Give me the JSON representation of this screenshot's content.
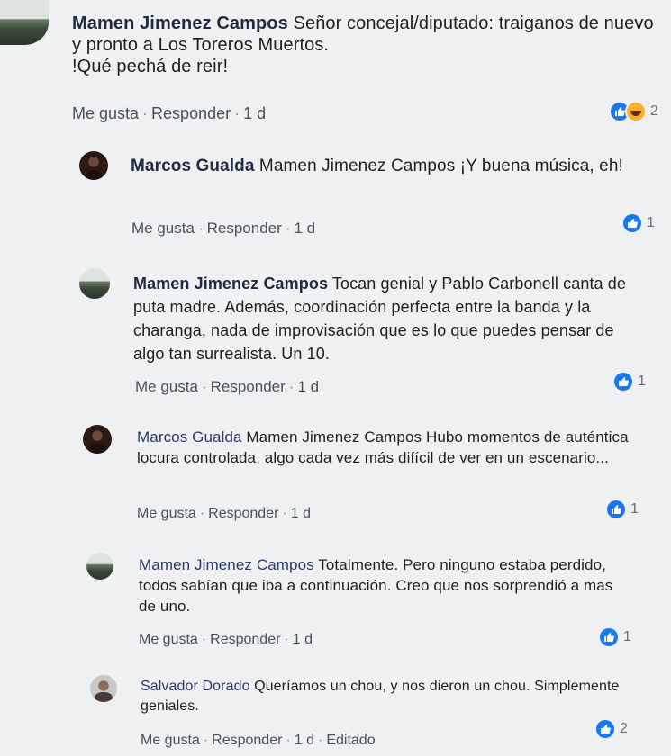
{
  "comments": [
    {
      "author": "Mamen Jimenez Campos",
      "text": "Señor concejal/diputado: traiganos de nuevo y pronto a Los Toreros Muertos.",
      "text2": "!Qué pechá de reir!",
      "like": "Me gusta",
      "reply": "Responder",
      "time": "1 d",
      "reaction_count": "2"
    },
    {
      "author": "Marcos Gualda",
      "text": "Mamen Jimenez Campos ¡Y buena música, eh!",
      "like": "Me gusta",
      "reply": "Responder",
      "time": "1 d",
      "reaction_count": "1"
    },
    {
      "author": "Mamen Jimenez Campos",
      "text": "Tocan genial y Pablo Carbonell canta de puta madre. Además, coordinación perfecta entre la banda y la charanga, nada de improvisación que es lo que puedes pensar de algo tan surrealista. Un 10.",
      "like": "Me gusta",
      "reply": "Responder",
      "time": "1 d",
      "reaction_count": "1"
    },
    {
      "author": "Marcos Gualda",
      "text": "Mamen Jimenez Campos Hubo momentos de auténtica locura controlada, algo cada vez más difícil de ver en un escenario...",
      "like": "Me gusta",
      "reply": "Responder",
      "time": "1 d",
      "reaction_count": "1"
    },
    {
      "author": "Mamen Jimenez Campos",
      "text": "Totalmente. Pero ninguno estaba perdido, todos sabían que iba a continuación. Creo que nos sorprendió a mas de uno.",
      "like": "Me gusta",
      "reply": "Responder",
      "time": "1 d",
      "reaction_count": "1"
    },
    {
      "author": "Salvador Dorado",
      "text": "Queríamos un chou, y nos dieron un chou. Simplemente geniales.",
      "like": "Me gusta",
      "reply": "Responder",
      "time": "1 d",
      "edited": "Editado",
      "reaction_count": "2"
    }
  ],
  "icons": {
    "like": "like-icon",
    "haha": "haha-icon",
    "avatar": "avatar"
  },
  "colors": {
    "like_blue": "#1877f2",
    "haha_yellow": "#f7b125",
    "author": "#1f2a44",
    "meta": "#4c5157"
  }
}
